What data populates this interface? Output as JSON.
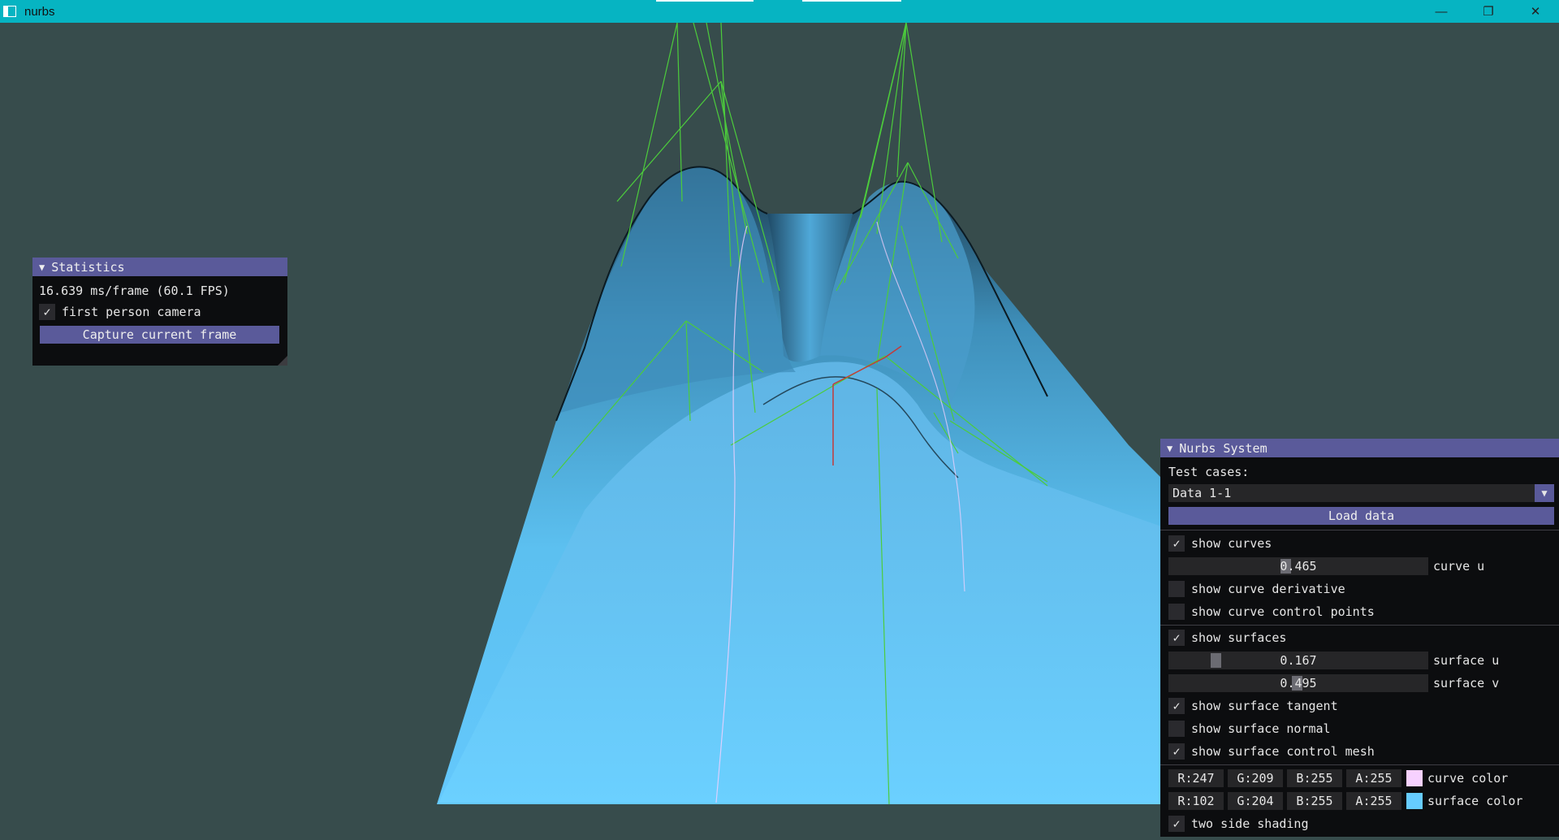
{
  "window": {
    "title": "nurbs",
    "controls": [
      "—",
      "❐",
      "✕"
    ]
  },
  "statistics": {
    "title": "Statistics",
    "frame_time": "16.639 ms/frame (60.1 FPS)",
    "first_person_label": "first person camera",
    "first_person_checked": true,
    "capture_label": "Capture current frame"
  },
  "nurbs": {
    "title": "Nurbs System",
    "test_cases_label": "Test cases:",
    "test_case_value": "Data 1-1",
    "load_label": "Load data",
    "show_curves": "show curves",
    "curve_u_value": "0.465",
    "curve_u_fraction": 0.465,
    "curve_u_label": "curve u",
    "show_curve_derivative": "show curve derivative",
    "show_curve_control_points": "show curve control points",
    "show_surfaces": "show surfaces",
    "surface_u_value": "0.167",
    "surface_u_fraction": 0.167,
    "surface_u_label": "surface u",
    "surface_v_value": "0.495",
    "surface_v_fraction": 0.495,
    "surface_v_label": "surface v",
    "show_surface_tangent": "show surface tangent",
    "show_surface_normal": "show surface normal",
    "show_surface_control_mesh": "show surface control mesh",
    "curve_color": {
      "r": "R:247",
      "g": "G:209",
      "b": "B:255",
      "a": "A:255",
      "label": "curve color",
      "hex": "#f7d1ff"
    },
    "surface_color": {
      "r": "R:102",
      "g": "G:204",
      "b": "B:255",
      "a": "A:255",
      "label": "surface color",
      "hex": "#66ccff"
    },
    "two_side_shading": "two side shading",
    "check_glyph": "✓"
  },
  "colors": {
    "background": "#374c4c",
    "titlebar": "#06b4c2",
    "imgui_accent": "#5a5a9a",
    "control_mesh": "#4ccc3c"
  }
}
